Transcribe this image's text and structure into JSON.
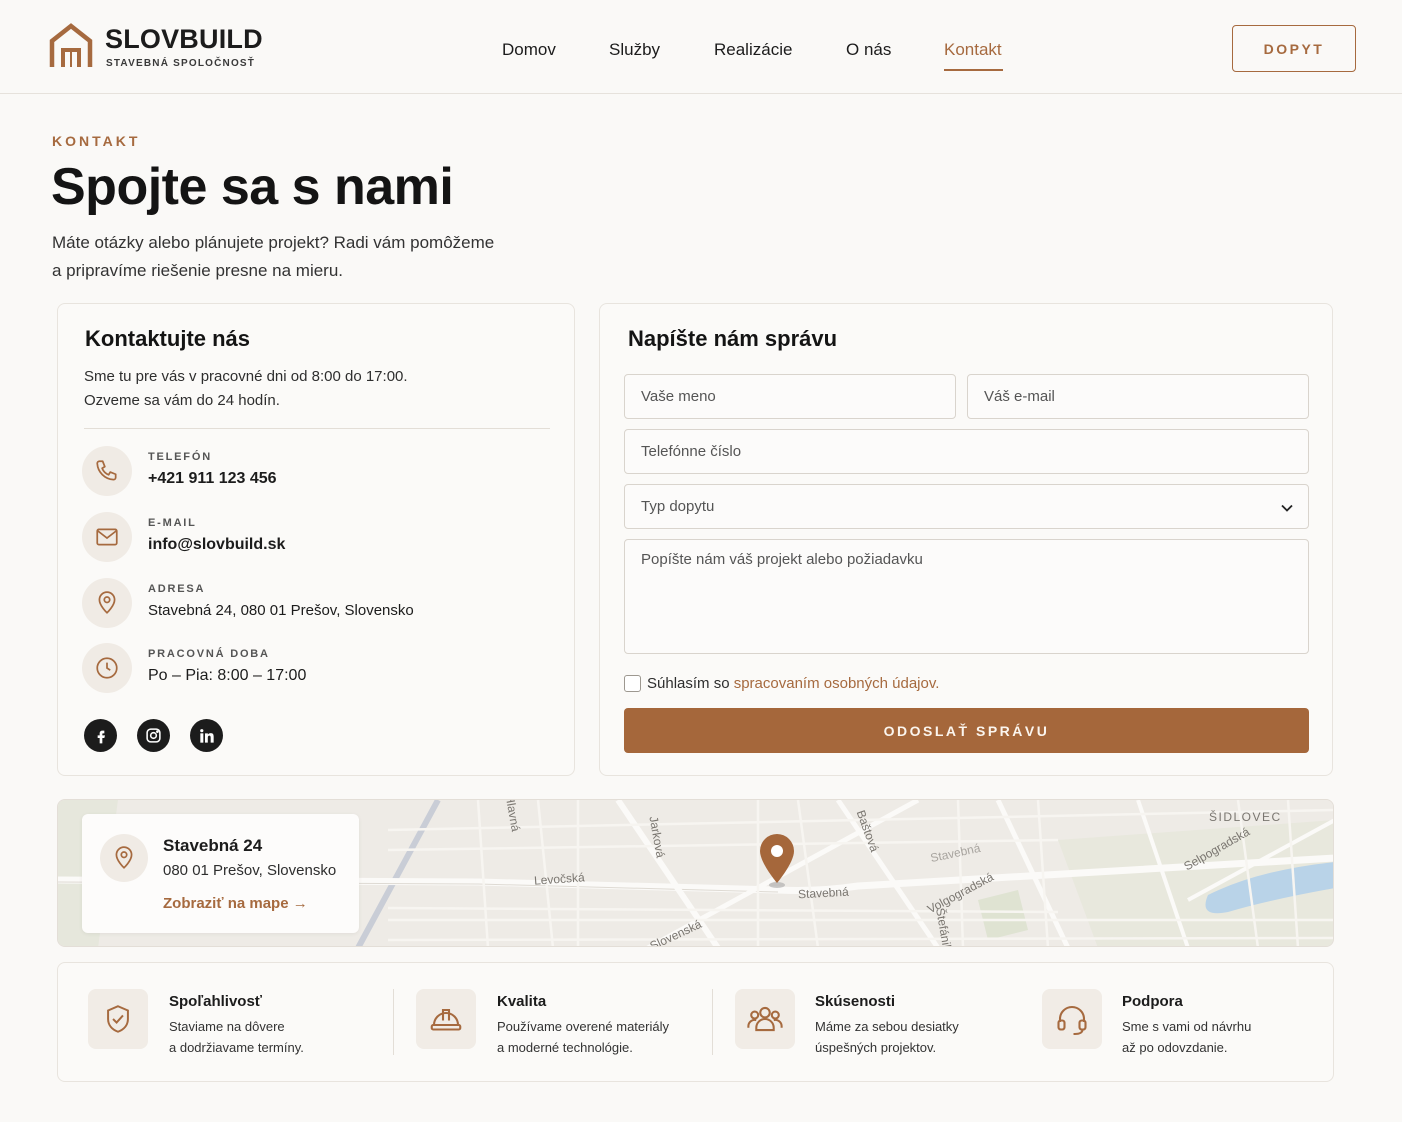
{
  "colors": {
    "accent": "#a66a3f",
    "button": "#a5673b",
    "icon_bg": "#f0ebe5",
    "social_bg": "#1c1c1c"
  },
  "header": {
    "brand_name": "SLOVBUILD",
    "brand_sub": "STAVEBNÁ SPOLOČNOSŤ",
    "nav": [
      {
        "label": "Domov"
      },
      {
        "label": "Služby"
      },
      {
        "label": "Realizácie"
      },
      {
        "label": "O nás"
      },
      {
        "label": "Kontakt",
        "active": true
      }
    ],
    "cta_label": "DOPYT"
  },
  "hero": {
    "eyebrow": "KONTAKT",
    "title": "Spojte sa s nami",
    "desc_line1": "Máte otázky alebo plánujete projekt? Radi vám pomôžeme",
    "desc_line2": "a pripravíme riešenie presne na mieru."
  },
  "contact": {
    "title": "Kontaktujte nás",
    "desc_line1": "Sme tu pre vás v pracovné dni od 8:00 do 17:00.",
    "desc_line2": "Ozveme sa vám do 24 hodín.",
    "items": [
      {
        "icon": "phone-icon",
        "label": "TELEFÓN",
        "value": "+421 911 123 456"
      },
      {
        "icon": "mail-icon",
        "label": "E-MAIL",
        "value": "info@slovbuild.sk"
      },
      {
        "icon": "location-pin-icon",
        "label": "ADRESA",
        "value": "Stavebná 24, 080 01 Prešov, Slovensko"
      },
      {
        "icon": "clock-icon",
        "label": "PRACOVNÁ DOBA",
        "value": "Po – Pia: 8:00 – 17:00"
      }
    ],
    "social": [
      "facebook-icon",
      "instagram-icon",
      "linkedin-icon"
    ]
  },
  "form": {
    "title": "Napíšte nám správu",
    "name_placeholder": "Vaše meno",
    "email_placeholder": "Váš e-mail",
    "phone_placeholder": "Telefónne číslo",
    "type_selected": "Typ dopytu",
    "message_placeholder": "Popíšte nám váš projekt alebo požiadavku",
    "consent_prefix": "Súhlasím so ",
    "consent_link": "spracovaním osobných údajov.",
    "consent_checked": false,
    "submit_label": "ODOSLAŤ SPRÁVU"
  },
  "map": {
    "title": "Stavebná 24",
    "address": "080 01 Prešov, Slovensko",
    "link_label": "Zobraziť na mape",
    "streets": [
      "Levočská",
      "Stavebná",
      "Volgogradská",
      "Selpogradská",
      "ŠIDLOVEC",
      "Jarková",
      "Baštová",
      "Slovenská",
      "Hlavná",
      "Štefánikova",
      "Stavebná"
    ]
  },
  "features": [
    {
      "icon": "shield-check-icon",
      "title": "Spoľahlivosť",
      "line1": "Staviame na dôvere",
      "line2": "a dodržiavame termíny."
    },
    {
      "icon": "hard-hat-icon",
      "title": "Kvalita",
      "line1": "Používame overené materiály",
      "line2": "a moderné technológie."
    },
    {
      "icon": "team-icon",
      "title": "Skúsenosti",
      "line1": "Máme za sebou desiatky",
      "line2": "úspešných projektov."
    },
    {
      "icon": "headset-icon",
      "title": "Podpora",
      "line1": "Sme s vami od návrhu",
      "line2": "až po odovzdanie."
    }
  ]
}
